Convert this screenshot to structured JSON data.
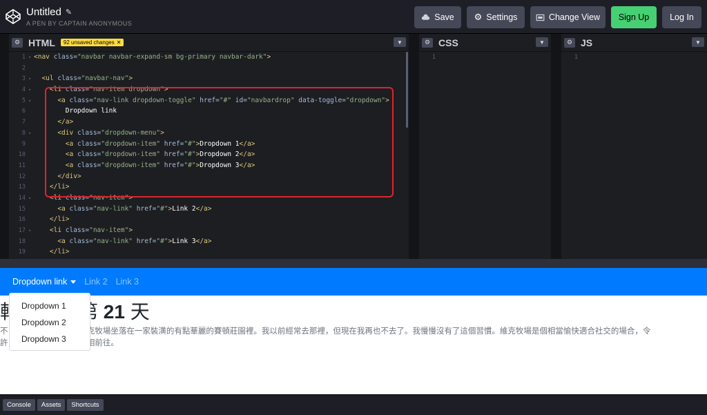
{
  "header": {
    "title": "Untitled",
    "subtitle": "A PEN BY CAPTAIN ANONYMOUS",
    "buttons": {
      "save": "Save",
      "settings": "Settings",
      "change_view": "Change View",
      "signup": "Sign Up",
      "login": "Log In"
    }
  },
  "panes": {
    "html": {
      "title": "HTML",
      "badge": "92 unsaved changes"
    },
    "css": {
      "title": "CSS",
      "line1": "1"
    },
    "js": {
      "title": "JS",
      "line1": "1"
    }
  },
  "code_lines": [
    {
      "n": "1",
      "fold": "▾",
      "text": "<nav class=\"navbar navbar-expand-sm bg-primary navbar-dark\">"
    },
    {
      "n": "2",
      "fold": "",
      "text": ""
    },
    {
      "n": "3",
      "fold": "▾",
      "text": "  <ul class=\"navbar-nav\">"
    },
    {
      "n": "4",
      "fold": "▾",
      "text": "    <li class=\"nav-item dropdown\">"
    },
    {
      "n": "5",
      "fold": "▾",
      "text": "      <a class=\"nav-link dropdown-toggle\" href=\"#\" id=\"navbardrop\" data-toggle=\"dropdown\">"
    },
    {
      "n": "6",
      "fold": "",
      "text": "        Dropdown link"
    },
    {
      "n": "7",
      "fold": "",
      "text": "      </a>"
    },
    {
      "n": "8",
      "fold": "▾",
      "text": "      <div class=\"dropdown-menu\">"
    },
    {
      "n": "9",
      "fold": "",
      "text": "        <a class=\"dropdown-item\" href=\"#\">Dropdown 1</a>"
    },
    {
      "n": "10",
      "fold": "",
      "text": "        <a class=\"dropdown-item\" href=\"#\">Dropdown 2</a>"
    },
    {
      "n": "11",
      "fold": "",
      "text": "        <a class=\"dropdown-item\" href=\"#\">Dropdown 3</a>"
    },
    {
      "n": "12",
      "fold": "",
      "text": "      </div>"
    },
    {
      "n": "13",
      "fold": "",
      "text": "    </li>"
    },
    {
      "n": "14",
      "fold": "▾",
      "text": "    <li class=\"nav-item\">"
    },
    {
      "n": "15",
      "fold": "",
      "text": "      <a class=\"nav-link\" href=\"#\">Link 2</a>"
    },
    {
      "n": "16",
      "fold": "",
      "text": "    </li>"
    },
    {
      "n": "17",
      "fold": "▾",
      "text": "    <li class=\"nav-item\">"
    },
    {
      "n": "18",
      "fold": "",
      "text": "      <a class=\"nav-link\" href=\"#\">Link 3</a>"
    },
    {
      "n": "19",
      "fold": "",
      "text": "    </li>"
    }
  ],
  "preview": {
    "nav": {
      "dropdown": "Dropdown link",
      "link2": "Link 2",
      "link3": "Link 3"
    },
    "dropdown_items": [
      "Dropdown 1",
      "Dropdown 2",
      "Dropdown 3"
    ],
    "heading_prefix": "輔",
    "heading_mid": "第 ",
    "heading_num": "21",
    "heading_suffix": " 天",
    "para_line1": "不                         道，維克牧場坐落在一家裝潢的有點華麗的賽頓莊園裡。我以前經常去那裡，但現在我再也不去了。我慢慢沒有了這個習慣。維克牧場是個相當愉快適合社交的場合，令",
    "para_line2": "許                         馬們爭相前往。"
  },
  "footer": {
    "console": "Console",
    "assets": "Assets",
    "shortcuts": "Shortcuts"
  },
  "colors": {
    "accent_green": "#47cf73",
    "navbar_blue": "#007bff",
    "highlight_red": "#e0232e",
    "badge_yellow": "#ffdd40"
  }
}
